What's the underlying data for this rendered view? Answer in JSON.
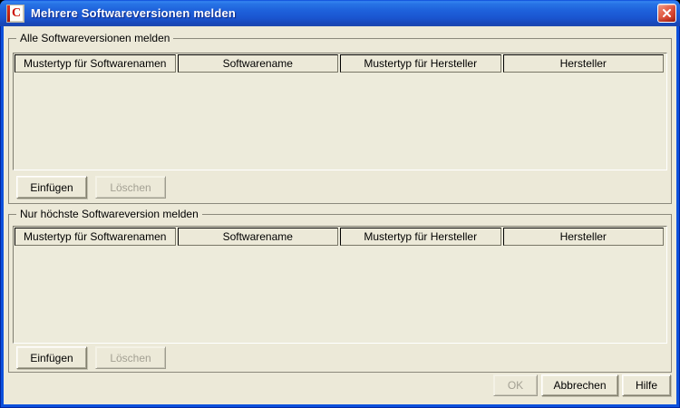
{
  "window": {
    "title": "Mehrere Softwareversionen melden"
  },
  "app_icon": {
    "letter": "C"
  },
  "icons": {
    "app": "consoleone-c-icon",
    "close": "close-x"
  },
  "columns": [
    "Mustertyp für Softwarenamen",
    "Softwarename",
    "Mustertyp für Hersteller",
    "Hersteller"
  ],
  "groups": [
    {
      "label": "Alle Softwareversionen melden",
      "insert_label": "Einfügen",
      "delete_label": "Löschen",
      "rows": []
    },
    {
      "label": "Nur höchste Softwareversion melden",
      "insert_label": "Einfügen",
      "delete_label": "Löschen",
      "rows": []
    }
  ],
  "footer": {
    "ok_label": "OK",
    "cancel_label": "Abbrechen",
    "help_label": "Hilfe"
  },
  "colors": {
    "titlebar_top": "#3585F0",
    "titlebar_bottom": "#1C47AE",
    "window_border": "#0C50DC",
    "dialog_bg": "#ECE9D8",
    "table_bg": "#EDEBDB",
    "disabled_text": "#A3A093",
    "close_button_red": "#D6432E"
  }
}
